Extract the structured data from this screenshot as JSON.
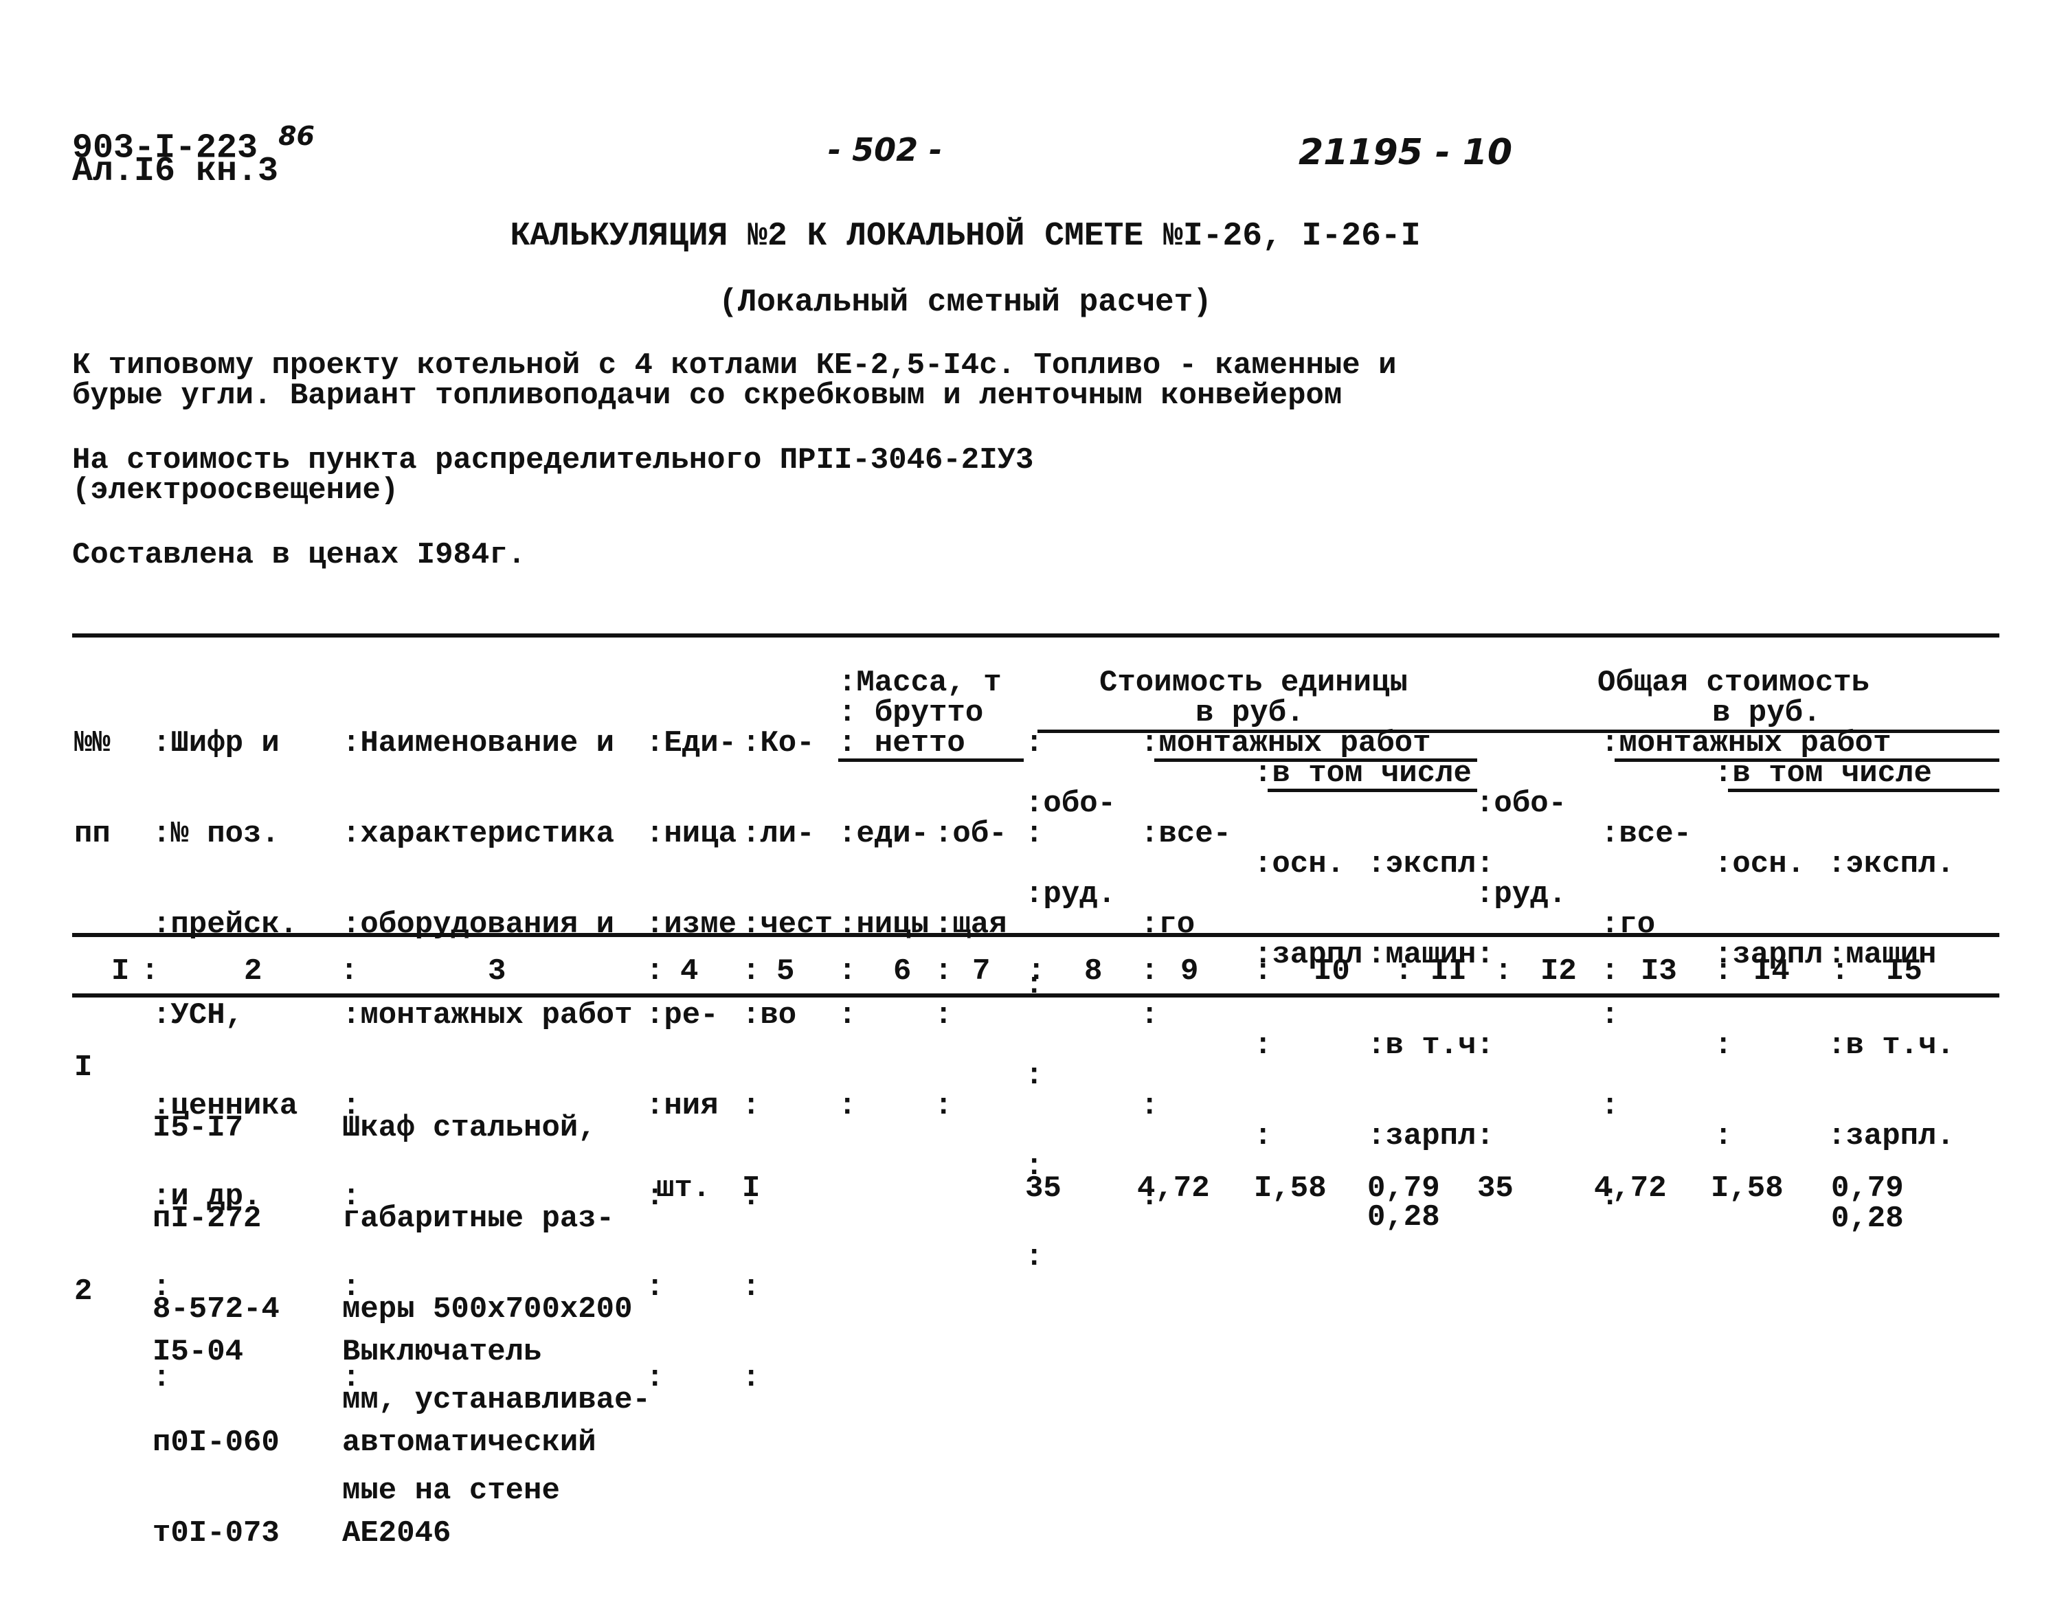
{
  "header": {
    "doc_code": "903-I-223",
    "doc_code_suffix": "86",
    "album": "Ал.I6 кн.3",
    "page_number": "- 502 -",
    "archive_number": "21195 - 10"
  },
  "title": "КАЛЬКУЛЯЦИЯ №2 К ЛОКАЛЬНОЙ СМЕТЕ №I-26, I-26-I",
  "subtitle": "(Локальный сметный расчет)",
  "intro": {
    "line1": "К типовому проекту котельной с 4 котлами КЕ-2,5-I4с. Топливо - каменные и",
    "line2": "бурые угли. Вариант топливоподачи со скребковым и ленточным конвейером",
    "object_line1": "На стоимость пункта распределительного ПРII-3046-2IУ3",
    "object_line2": "(электроосвещение)",
    "prices": "Составлена в ценах I984г."
  },
  "table": {
    "header": {
      "c1": [
        "№№",
        "пп"
      ],
      "c2": [
        ":Шифр и",
        ":№ поз.",
        ":прейск.",
        ":УСН,",
        ":ценника",
        ":и др.",
        ":",
        ":"
      ],
      "c3": [
        ":Наименование и",
        ":характеристика",
        ":оборудования и",
        ":монтажных работ",
        ":",
        ":",
        ":",
        ":"
      ],
      "c4": [
        ":Еди-",
        ":ница",
        ":изме",
        ":ре-",
        ":ния",
        ":",
        ":",
        ":"
      ],
      "c5": [
        ":Ко-",
        ":ли-",
        ":чест",
        ":во",
        ":",
        ":",
        ":",
        ":"
      ],
      "mass_title": ":Масса, т",
      "mass_brutto": ": брутто",
      "mass_netto": ": нетто",
      "c6": [
        ":еди-",
        ":ницы",
        ":",
        ":"
      ],
      "c7": [
        ":об-",
        ":щая",
        ":",
        ":"
      ],
      "unit_cost_title": "Стоимость единицы",
      "unit_cost_sub": "в руб.",
      "total_cost_title": "Общая стоимость",
      "total_cost_sub": "в руб.",
      "equip": [
        ":обо-",
        ":руд."
      ],
      "install": ":монтажных работ",
      "total_word": [
        ":все-",
        ":го"
      ],
      "including": ":в том числе",
      "base_wage": [
        ":осн.",
        ":зарпл"
      ],
      "machine_unit": [
        ":экспл:",
        ":машин:",
        ":в т.ч:",
        ":зарпл:"
      ],
      "machine_total": [
        ":экспл.",
        ":машин",
        ":в т.ч.",
        ":зарпл."
      ],
      "colon": ":"
    },
    "column_numbers": [
      "I",
      "2",
      "3",
      "4",
      "5",
      "6",
      "7",
      "8",
      "9",
      "I0",
      "II",
      "I2",
      "I3",
      "I4",
      "I5"
    ],
    "rows": [
      {
        "num": "I",
        "code": [
          "I5-I7",
          "пI-272",
          "8-572-4"
        ],
        "name": [
          "Шкаф стальной,",
          "габаритные раз-",
          "меры 500х700х200",
          "мм, устанавливае-",
          "мые на стене"
        ],
        "unit": "шт.",
        "qty": "I",
        "unit_equip": "35",
        "unit_install_total": "4,72",
        "unit_base_wage": "I,58",
        "unit_machine": "0,79",
        "unit_machine_wage": "0,28",
        "total_equip": "35",
        "total_install_total": "4,72",
        "total_base_wage": "I,58",
        "total_machine": "0,79",
        "total_machine_wage": "0,28"
      },
      {
        "num": "2",
        "code": [
          "I5-04",
          "п0I-060",
          "т0I-073"
        ],
        "name": [
          "Выключатель",
          "автоматический",
          "АЕ2046"
        ]
      }
    ]
  }
}
